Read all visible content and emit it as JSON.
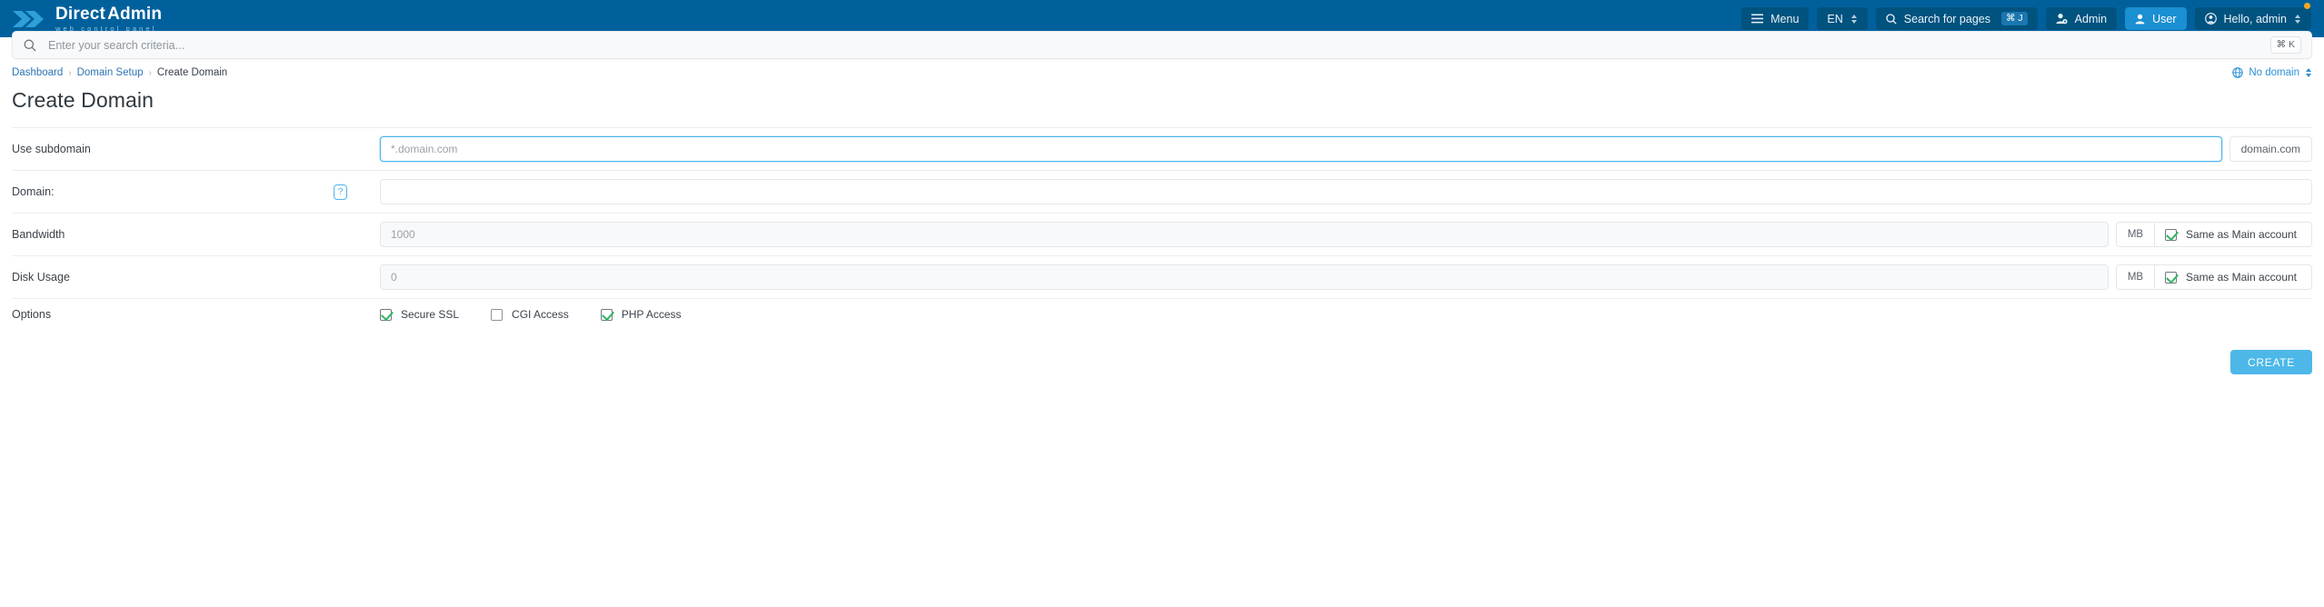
{
  "header": {
    "brand": {
      "title_part1": "Direct",
      "title_part2": "Admin",
      "subtitle": "web control panel",
      "logo_icon": "chevrons-icon"
    },
    "menu_button": {
      "label": "Menu",
      "icon": "hamburger-icon"
    },
    "language_button": {
      "label": "EN",
      "icon": "chevron-updown-icon"
    },
    "search_pages_button": {
      "label": "Search for pages",
      "shortcut": "⌘ J",
      "icon": "search-icon"
    },
    "admin_button": {
      "label": "Admin",
      "icon": "user-gear-icon"
    },
    "user_button": {
      "label": "User",
      "icon": "user-icon"
    },
    "account_button": {
      "label": "Hello, admin",
      "icon": "account-circle-icon"
    },
    "colors": {
      "bar": "#00609C",
      "button": "#00537f",
      "active_user": "#1a8fd2",
      "notification_dot": "#f5a623"
    }
  },
  "search": {
    "placeholder": "Enter your search criteria...",
    "value": "",
    "shortcut": "⌘ K",
    "icon": "search-icon"
  },
  "breadcrumb": {
    "items": [
      {
        "label": "Dashboard",
        "current": false
      },
      {
        "label": "Domain Setup",
        "current": false
      },
      {
        "label": "Create Domain",
        "current": true
      }
    ],
    "separator": "›"
  },
  "domain_selector": {
    "label": "No domain",
    "icon": "globe-icon"
  },
  "page": {
    "title": "Create Domain"
  },
  "form": {
    "use_subdomain": {
      "label": "Use subdomain",
      "placeholder": "*.domain.com",
      "value": "",
      "suffix": "domain.com"
    },
    "domain": {
      "label": "Domain:",
      "help_icon_label": "?",
      "placeholder": "",
      "value": ""
    },
    "bandwidth": {
      "label": "Bandwidth",
      "value": "1000",
      "unit": "MB",
      "same_as_main_label": "Same as Main account",
      "same_as_main_checked": true
    },
    "disk_usage": {
      "label": "Disk Usage",
      "value": "0",
      "unit": "MB",
      "same_as_main_label": "Same as Main account",
      "same_as_main_checked": true
    },
    "options": {
      "label": "Options",
      "items": [
        {
          "label": "Secure SSL",
          "checked": true
        },
        {
          "label": "CGI Access",
          "checked": false
        },
        {
          "label": "PHP Access",
          "checked": true
        }
      ]
    },
    "submit": {
      "label": "CREATE",
      "color": "#4DB8E8"
    }
  }
}
